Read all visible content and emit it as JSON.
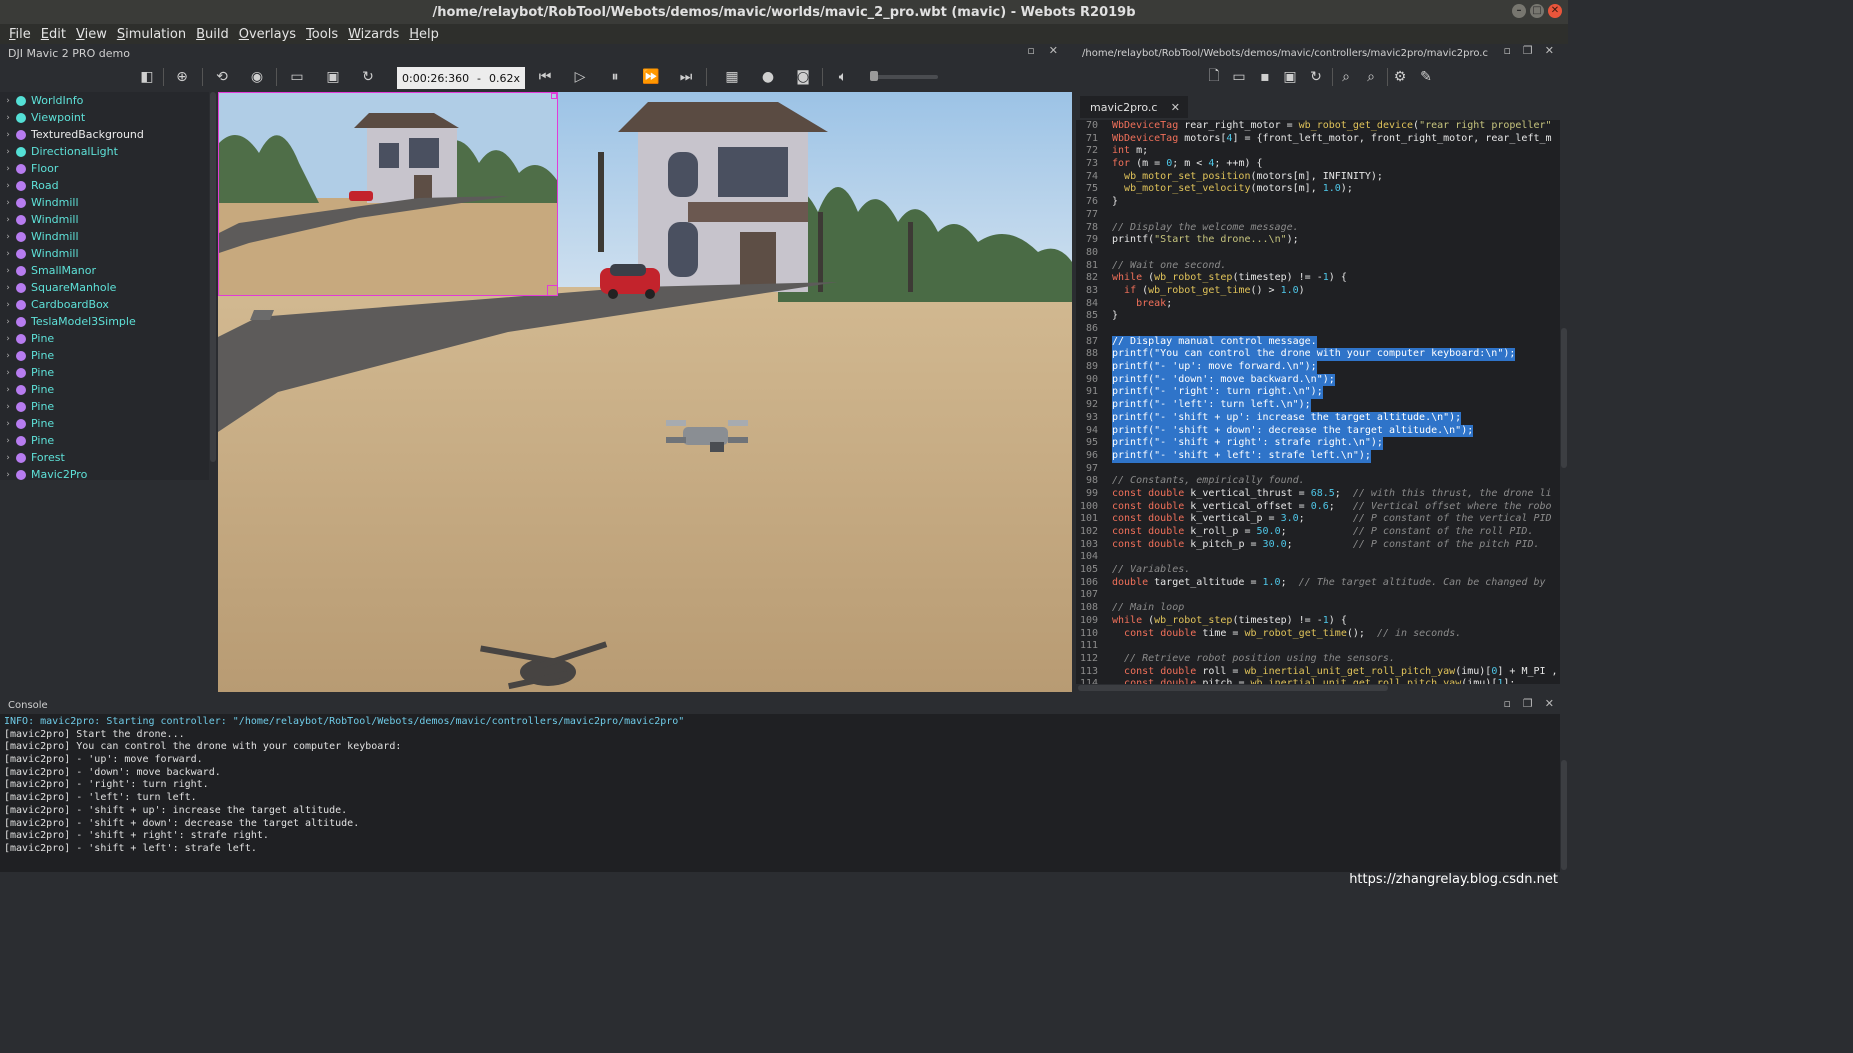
{
  "window": {
    "title": "/home/relaybot/RobTool/Webots/demos/mavic/worlds/mavic_2_pro.wbt (mavic) - Webots R2019b",
    "controls": [
      "–",
      "□",
      "✕"
    ]
  },
  "menu": {
    "items": [
      {
        "key": "F",
        "rest": "ile"
      },
      {
        "key": "E",
        "rest": "dit"
      },
      {
        "key": "V",
        "rest": "iew"
      },
      {
        "key": "S",
        "rest": "imulation"
      },
      {
        "key": "B",
        "rest": "uild"
      },
      {
        "key": "O",
        "rest": "verlays"
      },
      {
        "key": "T",
        "rest": "ools"
      },
      {
        "key": "W",
        "rest": "izards"
      },
      {
        "key": "H",
        "rest": "elp"
      }
    ]
  },
  "world_panel": {
    "title": "DJI Mavic 2 PRO demo",
    "sim_time": "0:00:26:360",
    "sim_sep": "-",
    "speed": "0.62x"
  },
  "scene_tree": [
    {
      "label": "WorldInfo",
      "dot": "#54e0d6",
      "color": "cyan"
    },
    {
      "label": "Viewpoint",
      "dot": "#54e0d6",
      "color": "cyan"
    },
    {
      "label": "TexturedBackground",
      "dot": "#b77cf0",
      "color": "white"
    },
    {
      "label": "DirectionalLight",
      "dot": "#54e0d6",
      "color": "cyan"
    },
    {
      "label": "Floor",
      "dot": "#b77cf0",
      "color": "cyan"
    },
    {
      "label": "Road",
      "dot": "#b77cf0",
      "color": "cyan"
    },
    {
      "label": "Windmill",
      "dot": "#b77cf0",
      "color": "cyan"
    },
    {
      "label": "Windmill",
      "dot": "#b77cf0",
      "color": "cyan"
    },
    {
      "label": "Windmill",
      "dot": "#b77cf0",
      "color": "cyan"
    },
    {
      "label": "Windmill",
      "dot": "#b77cf0",
      "color": "cyan"
    },
    {
      "label": "SmallManor",
      "dot": "#b77cf0",
      "color": "cyan"
    },
    {
      "label": "SquareManhole",
      "dot": "#b77cf0",
      "color": "cyan"
    },
    {
      "label": "CardboardBox",
      "dot": "#b77cf0",
      "color": "cyan"
    },
    {
      "label": "TeslaModel3Simple",
      "dot": "#b77cf0",
      "color": "cyan"
    },
    {
      "label": "Pine",
      "dot": "#b77cf0",
      "color": "cyan"
    },
    {
      "label": "Pine",
      "dot": "#b77cf0",
      "color": "cyan"
    },
    {
      "label": "Pine",
      "dot": "#b77cf0",
      "color": "cyan"
    },
    {
      "label": "Pine",
      "dot": "#b77cf0",
      "color": "cyan"
    },
    {
      "label": "Pine",
      "dot": "#b77cf0",
      "color": "cyan"
    },
    {
      "label": "Pine",
      "dot": "#b77cf0",
      "color": "cyan"
    },
    {
      "label": "Pine",
      "dot": "#b77cf0",
      "color": "cyan"
    },
    {
      "label": "Forest",
      "dot": "#b77cf0",
      "color": "cyan"
    },
    {
      "label": "Mavic2Pro",
      "dot": "#b77cf0",
      "color": "cyan"
    }
  ],
  "editor": {
    "path": "/home/relaybot/RobTool/Webots/demos/mavic/controllers/mavic2pro/mavic2pro.c",
    "tab": "mavic2pro.c",
    "lines": [
      {
        "n": "70",
        "t": "WbDeviceTag rear_right_motor = wb_robot_get_device(\"rear right propeller\""
      },
      {
        "n": "71",
        "t": "WbDeviceTag motors[4] = {front_left_motor, front_right_motor, rear_left_m"
      },
      {
        "n": "72",
        "t": "int m;"
      },
      {
        "n": "73",
        "t": "for (m = 0; m < 4; ++m) {"
      },
      {
        "n": "74",
        "t": "  wb_motor_set_position(motors[m], INFINITY);"
      },
      {
        "n": "75",
        "t": "  wb_motor_set_velocity(motors[m], 1.0);"
      },
      {
        "n": "76",
        "t": "}"
      },
      {
        "n": "77",
        "t": ""
      },
      {
        "n": "78",
        "t": "// Display the welcome message.",
        "kind": "comment"
      },
      {
        "n": "79",
        "t": "printf(\"Start the drone...\\n\");"
      },
      {
        "n": "80",
        "t": ""
      },
      {
        "n": "81",
        "t": "// Wait one second.",
        "kind": "comment"
      },
      {
        "n": "82",
        "t": "while (wb_robot_step(timestep) != -1) {"
      },
      {
        "n": "83",
        "t": "  if (wb_robot_get_time() > 1.0)"
      },
      {
        "n": "84",
        "t": "    break;"
      },
      {
        "n": "85",
        "t": "}"
      },
      {
        "n": "86",
        "t": ""
      },
      {
        "n": "87",
        "t": "// Display manual control message.",
        "kind": "sel"
      },
      {
        "n": "88",
        "t": "printf(\"You can control the drone with your computer keyboard:\\n\");",
        "kind": "sel"
      },
      {
        "n": "89",
        "t": "printf(\"- 'up': move forward.\\n\");",
        "kind": "sel"
      },
      {
        "n": "90",
        "t": "printf(\"- 'down': move backward.\\n\");",
        "kind": "sel"
      },
      {
        "n": "91",
        "t": "printf(\"- 'right': turn right.\\n\");",
        "kind": "sel"
      },
      {
        "n": "92",
        "t": "printf(\"- 'left': turn left.\\n\");",
        "kind": "sel"
      },
      {
        "n": "93",
        "t": "printf(\"- 'shift + up': increase the target altitude.\\n\");",
        "kind": "sel"
      },
      {
        "n": "94",
        "t": "printf(\"- 'shift + down': decrease the target altitude.\\n\");",
        "kind": "sel"
      },
      {
        "n": "95",
        "t": "printf(\"- 'shift + right': strafe right.\\n\");",
        "kind": "sel"
      },
      {
        "n": "96",
        "t": "printf(\"- 'shift + left': strafe left.\\n\");",
        "kind": "sel"
      },
      {
        "n": "97",
        "t": ""
      },
      {
        "n": "98",
        "t": "// Constants, empirically found.",
        "kind": "comment"
      },
      {
        "n": "99",
        "t": "const double k_vertical_thrust = 68.5;  // with this thrust, the drone li"
      },
      {
        "n": "100",
        "t": "const double k_vertical_offset = 0.6;   // Vertical offset where the robo"
      },
      {
        "n": "101",
        "t": "const double k_vertical_p = 3.0;        // P constant of the vertical PID"
      },
      {
        "n": "102",
        "t": "const double k_roll_p = 50.0;           // P constant of the roll PID."
      },
      {
        "n": "103",
        "t": "const double k_pitch_p = 30.0;          // P constant of the pitch PID."
      },
      {
        "n": "104",
        "t": ""
      },
      {
        "n": "105",
        "t": "// Variables.",
        "kind": "comment"
      },
      {
        "n": "106",
        "t": "double target_altitude = 1.0;  // The target altitude. Can be changed by"
      },
      {
        "n": "107",
        "t": ""
      },
      {
        "n": "108",
        "t": "// Main loop",
        "kind": "comment"
      },
      {
        "n": "109",
        "t": "while (wb_robot_step(timestep) != -1) {"
      },
      {
        "n": "110",
        "t": "  const double time = wb_robot_get_time();  // in seconds."
      },
      {
        "n": "111",
        "t": ""
      },
      {
        "n": "112",
        "t": "  // Retrieve robot position using the sensors.",
        "kind": "comment"
      },
      {
        "n": "113",
        "t": "  const double roll = wb_inertial_unit_get_roll_pitch_yaw(imu)[0] + M_PI ,"
      },
      {
        "n": "114",
        "t": "  const double pitch = wb_inertial_unit_get_roll_pitch_yaw(imu)[1];"
      }
    ]
  },
  "console": {
    "title": "Console",
    "lines": [
      {
        "t": "INFO: mavic2pro: Starting controller: \"/home/relaybot/RobTool/Webots/demos/mavic/controllers/mavic2pro/mavic2pro\"",
        "kind": "info"
      },
      {
        "t": "[mavic2pro] Start the drone..."
      },
      {
        "t": "[mavic2pro] You can control the drone with your computer keyboard:"
      },
      {
        "t": "[mavic2pro] - 'up': move forward."
      },
      {
        "t": "[mavic2pro] - 'down': move backward."
      },
      {
        "t": "[mavic2pro] - 'right': turn right."
      },
      {
        "t": "[mavic2pro] - 'left': turn left."
      },
      {
        "t": "[mavic2pro] - 'shift + up': increase the target altitude."
      },
      {
        "t": "[mavic2pro] - 'shift + down': decrease the target altitude."
      },
      {
        "t": "[mavic2pro] - 'shift + right': strafe right."
      },
      {
        "t": "[mavic2pro] - 'shift + left': strafe left."
      }
    ]
  },
  "watermark": "https://zhangrelay.blog.csdn.net"
}
